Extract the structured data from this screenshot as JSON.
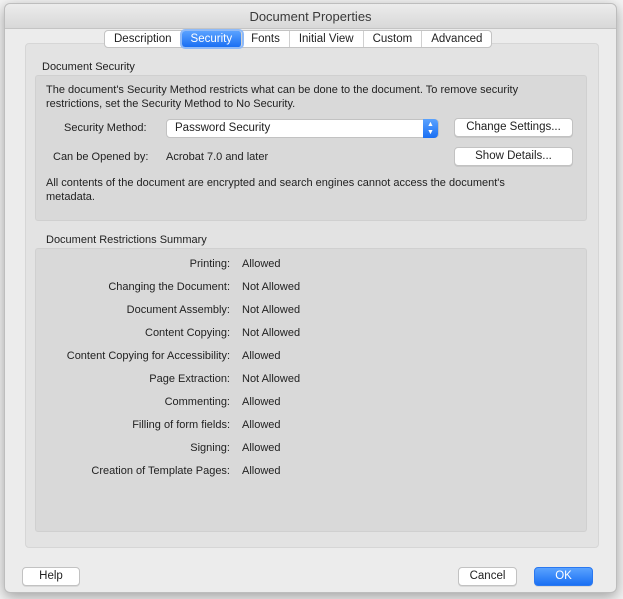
{
  "window": {
    "title": "Document Properties"
  },
  "tabs": [
    {
      "label": "Description"
    },
    {
      "label": "Security",
      "active": true
    },
    {
      "label": "Fonts"
    },
    {
      "label": "Initial View"
    },
    {
      "label": "Custom"
    },
    {
      "label": "Advanced"
    }
  ],
  "security": {
    "heading": "Document Security",
    "intro_line1": "The document's Security Method restricts what can be done to the document. To remove security",
    "intro_line2": "restrictions, set the Security Method to No Security.",
    "method_label": "Security Method:",
    "method_value": "Password Security",
    "change_settings": "Change Settings...",
    "opened_by_label": "Can be Opened by:",
    "opened_by_value": "Acrobat 7.0 and later",
    "show_details": "Show Details...",
    "note_line1": "All contents of the document are encrypted and search engines cannot access the document's",
    "note_line2": "metadata."
  },
  "restrictions": {
    "heading": "Document Restrictions Summary",
    "items": [
      {
        "label": "Printing:",
        "value": "Allowed"
      },
      {
        "label": "Changing the Document:",
        "value": "Not Allowed"
      },
      {
        "label": "Document Assembly:",
        "value": "Not Allowed"
      },
      {
        "label": "Content Copying:",
        "value": "Not Allowed"
      },
      {
        "label": "Content Copying for Accessibility:",
        "value": "Allowed"
      },
      {
        "label": "Page Extraction:",
        "value": "Not Allowed"
      },
      {
        "label": "Commenting:",
        "value": "Allowed"
      },
      {
        "label": "Filling of form fields:",
        "value": "Allowed"
      },
      {
        "label": "Signing:",
        "value": "Allowed"
      },
      {
        "label": "Creation of Template Pages:",
        "value": "Allowed"
      }
    ]
  },
  "footer": {
    "help": "Help",
    "cancel": "Cancel",
    "ok": "OK"
  },
  "colors": {
    "accent": "#1a6ff3"
  }
}
